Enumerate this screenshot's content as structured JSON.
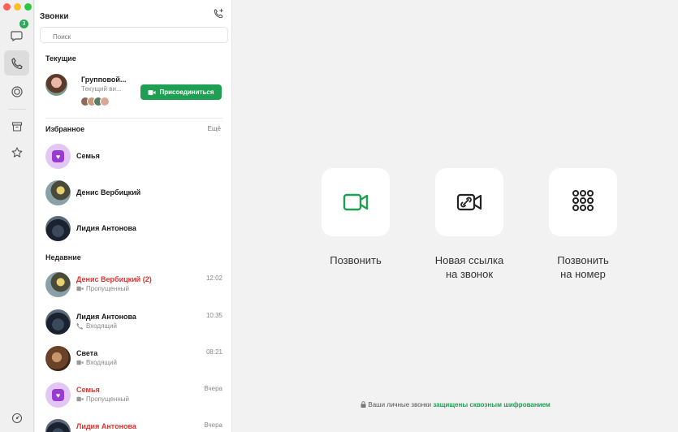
{
  "window": {
    "traffic_colors": [
      "#ff5f57",
      "#febc2e",
      "#28c840"
    ]
  },
  "rail": {
    "items": [
      {
        "name": "chats",
        "icon": "chat-bubble-icon",
        "badge": "3"
      },
      {
        "name": "calls",
        "icon": "phone-icon",
        "active": true
      },
      {
        "name": "stories",
        "icon": "circle-icon"
      },
      {
        "name": "archive",
        "icon": "archive-icon"
      },
      {
        "name": "favorites",
        "icon": "star-icon"
      },
      {
        "name": "settings",
        "icon": "settings-icon"
      }
    ]
  },
  "panel": {
    "title": "Звонки",
    "search_placeholder": "Поиск",
    "current_section": "Текущие",
    "current_call": {
      "name": "Групповой...",
      "subtitle": "Текущий ви...",
      "join_label": "Присоединиться"
    },
    "favorites_section": "Избранное",
    "favorites_more": "Ещё",
    "favorites": [
      {
        "name": "Семья",
        "avatar": "family"
      },
      {
        "name": "Денис Вербицкий",
        "avatar": "denis"
      },
      {
        "name": "Лидия Антонова",
        "avatar": "lidia"
      }
    ],
    "recent_section": "Недавние",
    "recent": [
      {
        "name": "Денис Вербицкий (2)",
        "status": "Пропущенный",
        "time": "12:02",
        "missed": true,
        "type": "video",
        "avatar": "denis"
      },
      {
        "name": "Лидия Антонова",
        "status": "Входящий",
        "time": "10:35",
        "missed": false,
        "type": "phone",
        "avatar": "lidia"
      },
      {
        "name": "Света",
        "status": "Входящий",
        "time": "08:21",
        "missed": false,
        "type": "video",
        "avatar": "sveta"
      },
      {
        "name": "Семья",
        "status": "Пропущенный",
        "time": "Вчера",
        "missed": true,
        "type": "video",
        "avatar": "family"
      },
      {
        "name": "Лидия Антонова",
        "status": "",
        "time": "Вчера",
        "missed": true,
        "type": "video",
        "avatar": "lidia"
      }
    ]
  },
  "main": {
    "actions": [
      {
        "label_line1": "Позвонить",
        "label_line2": "",
        "icon": "video-camera-icon"
      },
      {
        "label_line1": "Новая ссылка",
        "label_line2": "на звонок",
        "icon": "link-camera-icon"
      },
      {
        "label_line1": "Позвонить",
        "label_line2": "на номер",
        "icon": "dialpad-icon"
      }
    ],
    "footer_text": "Ваши личные звонки",
    "footer_link": "защищены сквозным шифрованием"
  },
  "colors": {
    "accent": "#1f9f52",
    "missed": "#e0332f",
    "family_avatar": "#9a3bd0"
  }
}
